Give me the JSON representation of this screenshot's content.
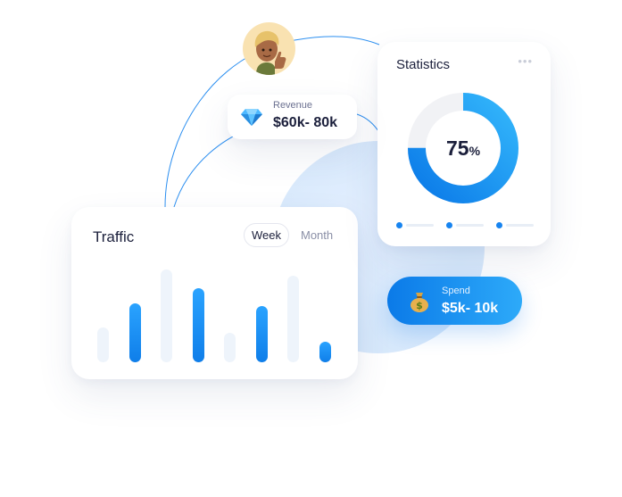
{
  "colors": {
    "accent": "#1784f0",
    "accent_light": "#2daaf9",
    "track": "#eef4fb",
    "text": "#1b1f3b",
    "muted": "#8a8fa6"
  },
  "avatar": {
    "icon": "user-avatar-thumbs-up"
  },
  "revenue": {
    "icon": "diamond-icon",
    "label": "Revenue",
    "value": "$60k- 80k"
  },
  "statistics": {
    "title": "Statistics",
    "menu_icon": "more-dots-icon",
    "donut": {
      "value": 75,
      "value_text": "75",
      "unit": "%"
    },
    "legend_items": 3
  },
  "traffic": {
    "title": "Traffic",
    "tabs": [
      {
        "label": "Week",
        "active": true
      },
      {
        "label": "Month",
        "active": false
      }
    ]
  },
  "spend": {
    "icon": "money-bag-icon",
    "label": "Spend",
    "value": "$5k- 10k"
  },
  "chart_data": {
    "type": "bar",
    "categories": [
      "",
      "",
      "",
      "",
      "",
      "",
      "",
      "",
      ""
    ],
    "series": [
      {
        "values": [
          38,
          65,
          102,
          82,
          32,
          62,
          95,
          23
        ]
      }
    ],
    "highlighted": [
      false,
      true,
      false,
      true,
      false,
      true,
      false,
      true
    ],
    "ylim": [
      0,
      110
    ],
    "grid": false,
    "title": "",
    "xlabel": "",
    "ylabel": ""
  }
}
